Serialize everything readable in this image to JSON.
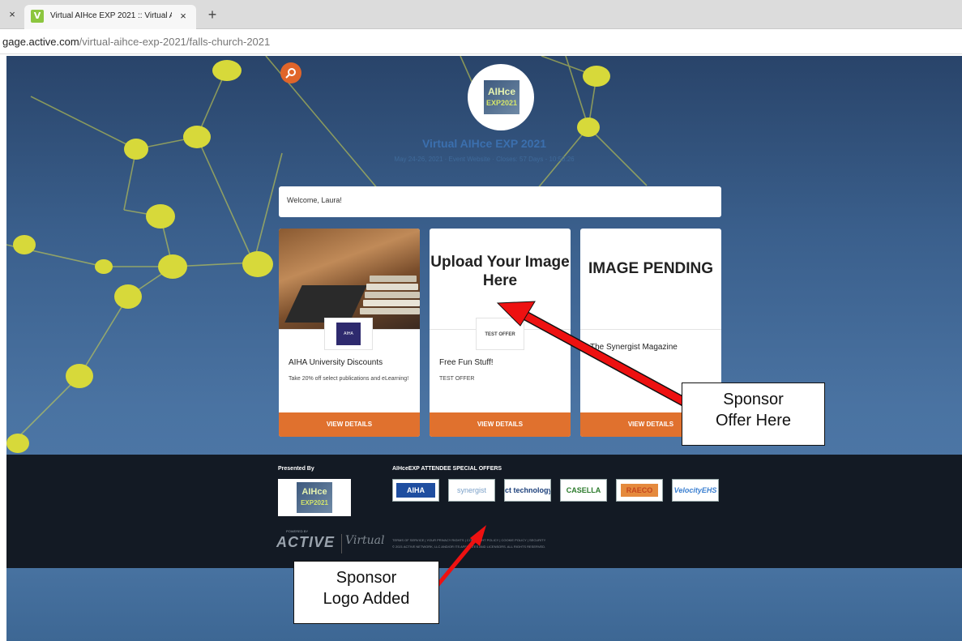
{
  "browser": {
    "tab_title": "Virtual AIHce EXP 2021 :: Virtual A",
    "favicon": "V",
    "close_left": "×",
    "close_tab": "×",
    "new_tab": "+",
    "url_host": "gage.active.com",
    "url_path": "/virtual-aihce-exp-2021/falls-church-2021"
  },
  "event": {
    "logo_text": "AIHce",
    "logo_sub": "EXP2021",
    "title": "Virtual AIHce EXP 2021",
    "meta": "May 24-26, 2021  ·  Event Website  ·  Closes: 57 Days - 10:58:26"
  },
  "welcome": "Welcome, Laura!",
  "cards": [
    {
      "name": "AIHA University Discounts",
      "desc": "Take 20% off select publications and eLearning!",
      "logo": "AIHA",
      "button": "VIEW DETAILS"
    },
    {
      "image_text": "Upload Your Image Here",
      "logo": "TEST OFFER",
      "name": "Free Fun Stuff!",
      "desc": "TEST OFFER",
      "button": "VIEW DETAILS"
    },
    {
      "image_text": "IMAGE PENDING",
      "name": "The Synergist Magazine",
      "button": "VIEW DETAILS"
    }
  ],
  "footer": {
    "presented_by": "Presented By",
    "offers_title": "AIHceEXP ATTENDEE SPECIAL OFFERS",
    "presented_logo": "AIHce",
    "presented_logo_sub": "EXP2021",
    "sponsors": [
      "AIHA",
      "synergist",
      "ct technology",
      "CASELLA",
      "RAECO",
      "VelocityEHS"
    ],
    "powered_by": "POWERED BY",
    "active": "ACTIVE",
    "virtual_logo": "Virtual",
    "legal_line1": "TERMS OF SERVICE  |  YOUR PRIVACY RIGHTS  |  COPYRIGHT POLICY  |  COOKIE POLICY  |  SECURITY",
    "legal_line2": "© 2021 ACTIVE NETWORK, LLC AND/OR ITS AFFILIATES AND LICENSORS. ALL RIGHTS RESERVED."
  },
  "annotations": {
    "offer_callout_line1": "Sponsor",
    "offer_callout_line2": "Offer Here",
    "logo_callout_line1": "Sponsor",
    "logo_callout_line2": "Logo Added"
  },
  "colors": {
    "accent_orange": "#e0712e",
    "arrow_red": "#ee1111",
    "node_yellow": "#d7d93a"
  }
}
